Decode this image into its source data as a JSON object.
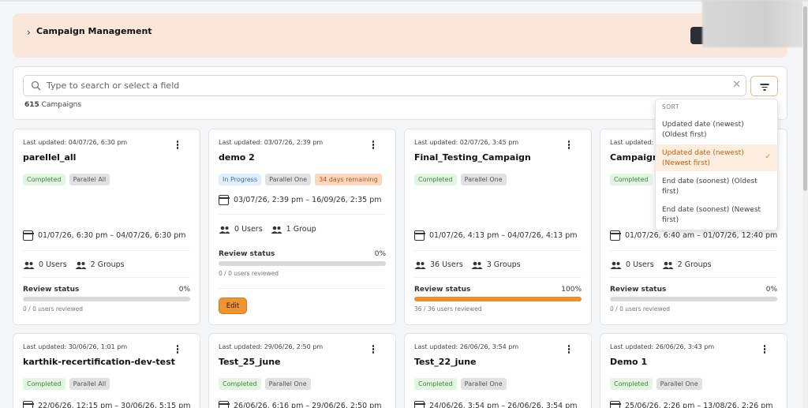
{
  "header": {
    "title": "Campaign Management"
  },
  "search": {
    "placeholder": "Type to search or select a field"
  },
  "campaign_count": {
    "number": "615",
    "label": "Campaigns"
  },
  "sort_menu": {
    "heading": "SORT",
    "items": [
      {
        "label": "Updated date (newest) (Oldest first)",
        "selected": false
      },
      {
        "label": "Updated date (newest) (Newest first)",
        "selected": true
      },
      {
        "label": "End date (soonest) (Oldest first)",
        "selected": false
      },
      {
        "label": "End date (soonest) (Newest first)",
        "selected": false
      }
    ],
    "check": "✓"
  },
  "cards": [
    {
      "updated": "Last updated: 04/07/26, 6:30 pm",
      "name": "parellel_all",
      "tags": [
        "Completed",
        "Parallel All"
      ],
      "dates": "01/07/26, 6:30 pm – 04/07/26, 6:30 pm",
      "users": "0 Users",
      "groups": "2 Groups",
      "review_label": "Review status",
      "review_pct": "0%",
      "progress": 0,
      "review_sub": "0 / 0 users reviewed"
    },
    {
      "updated": "Last updated: 03/07/26, 2:39 pm",
      "name": "demo 2",
      "tags": [
        "In Progress",
        "Parallel One",
        "34 days remaining"
      ],
      "dates": "03/07/26, 2:39 pm – 16/09/26, 2:35 pm",
      "users": "0 Users",
      "groups": "1 Group",
      "review_label": "Review status",
      "review_pct": "0%",
      "progress": 0,
      "review_sub": "0 / 0 users reviewed",
      "edit": "Edit"
    },
    {
      "updated": "Last updated: 02/07/26, 3:45 pm",
      "name": "Final_Testing_Campaign",
      "tags": [
        "Completed",
        "Parallel One"
      ],
      "dates": "01/07/26, 4:13 pm – 04/07/26, 4:13 pm",
      "users": "36 Users",
      "groups": "3 Groups",
      "review_label": "Review status",
      "review_pct": "100%",
      "progress": 100,
      "review_sub": "36 / 36 users reviewed"
    },
    {
      "updated": "Last updated: 0",
      "name": "Campaign_",
      "tags": [
        "Completed"
      ],
      "dates": "01/07/26, 6:40 am – 01/07/26, 12:40 pm",
      "users": "0 Users",
      "groups": "2 Groups",
      "review_label": "Review status",
      "review_pct": "0%",
      "progress": 0,
      "review_sub": "0 / 0 users reviewed"
    },
    {
      "updated": "Last updated: 30/06/26, 1:01 pm",
      "name": "karthik-recertification-dev-test",
      "tags": [
        "Completed",
        "Parallel All"
      ],
      "dates": "22/06/26, 12:15 pm – 30/06/26, 5:15 pm"
    },
    {
      "updated": "Last updated: 29/06/26, 2:50 pm",
      "name": "Test_25_june",
      "tags": [
        "Completed",
        "Parallel One"
      ],
      "dates": "26/06/26, 6:16 pm – 29/06/26, 2:50 pm"
    },
    {
      "updated": "Last updated: 26/06/26, 3:54 pm",
      "name": "Test_22_june",
      "tags": [
        "Completed",
        "Parallel One"
      ],
      "dates": "24/06/26, 3:54 pm – 26/06/26, 3:54 pm"
    },
    {
      "updated": "Last updated: 26/06/26, 3:43 pm",
      "name": "Demo 1",
      "tags": [
        "Completed",
        "Parallel One"
      ],
      "dates": "25/06/26, 2:26 pm – 13/08/26, 2:26 pm"
    }
  ],
  "colors": {
    "accent": "#f09330",
    "header_bg": "#fbe7da",
    "completed": "#3c8b3c"
  }
}
